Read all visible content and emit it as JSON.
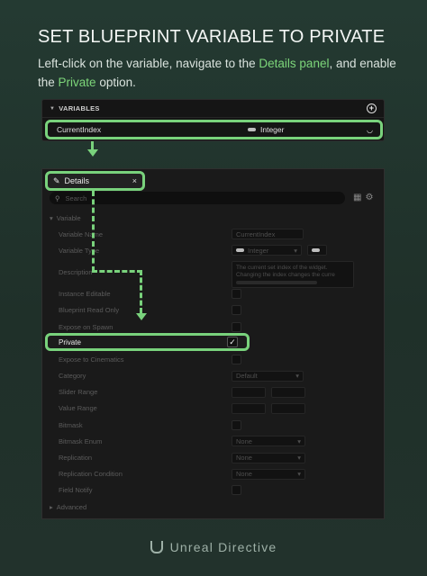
{
  "header": {
    "title": "SET BLUEPRINT VARIABLE TO PRIVATE",
    "subtitle_part1": "Left-click on the variable, navigate to the ",
    "subtitle_hl1": "Details panel",
    "subtitle_part2": ", and enable the ",
    "subtitle_hl2": "Private",
    "subtitle_part3": " option."
  },
  "variables_panel": {
    "header_label": "VARIABLES",
    "add_icon": "+",
    "variable_name": "CurrentIndex",
    "variable_type": "Integer"
  },
  "details_panel": {
    "tab_label": "Details",
    "close_label": "×",
    "search_placeholder": "Search",
    "category_variable": "Variable",
    "rows": {
      "variable_name_label": "Variable Name",
      "variable_name_value": "CurrentIndex",
      "variable_type_label": "Variable Type",
      "variable_type_value": "Integer",
      "description_label": "Description",
      "description_value": "The current set index of the widget. Changing the index changes the curre",
      "instance_editable": "Instance Editable",
      "blueprint_read_only": "Blueprint Read Only",
      "expose_on_spawn": "Expose on Spawn",
      "private_label": "Private",
      "private_check": "✓",
      "expose_to_cinematics": "Expose to Cinematics",
      "category_label": "Category",
      "category_value": "Default",
      "slider_range": "Slider Range",
      "value_range": "Value Range",
      "bitmask": "Bitmask",
      "bitmask_enum_label": "Bitmask Enum",
      "bitmask_enum_value": "None",
      "replication_label": "Replication",
      "replication_value": "None",
      "replication_condition_label": "Replication Condition",
      "replication_condition_value": "None",
      "field_notify": "Field Notify",
      "advanced": "Advanced"
    }
  },
  "footer": {
    "brand": "Unreal Directive"
  },
  "colors": {
    "accent": "#79d27c",
    "background": "#22362e"
  }
}
